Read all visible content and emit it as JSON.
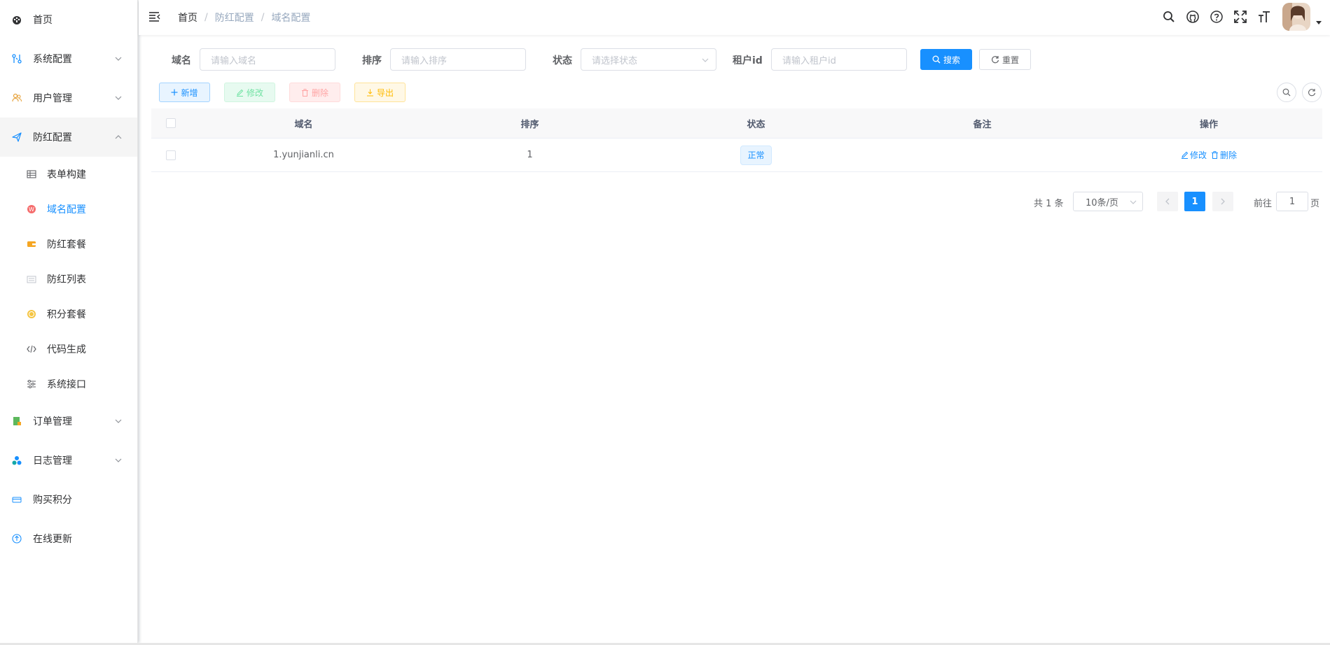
{
  "sidebar": {
    "items": [
      {
        "label": "首页"
      },
      {
        "label": "系统配置"
      },
      {
        "label": "用户管理"
      },
      {
        "label": "防红配置"
      },
      {
        "label": "订单管理"
      },
      {
        "label": "日志管理"
      },
      {
        "label": "购买积分"
      },
      {
        "label": "在线更新"
      }
    ],
    "sub_items": [
      {
        "label": "表单构建"
      },
      {
        "label": "域名配置"
      },
      {
        "label": "防红套餐"
      },
      {
        "label": "防红列表"
      },
      {
        "label": "积分套餐"
      },
      {
        "label": "代码生成"
      },
      {
        "label": "系统接口"
      }
    ]
  },
  "breadcrumb": {
    "home": "首页",
    "level1": "防红配置",
    "level2": "域名配置",
    "separator": "/"
  },
  "search_form": {
    "domain_label": "域名",
    "domain_placeholder": "请输入域名",
    "sort_label": "排序",
    "sort_placeholder": "请输入排序",
    "status_label": "状态",
    "status_placeholder": "请选择状态",
    "tenant_label": "租户id",
    "tenant_placeholder": "请输入租户id",
    "search_button": "搜索",
    "reset_button": "重置"
  },
  "toolbar": {
    "add": "新增",
    "edit": "修改",
    "delete": "删除",
    "export": "导出"
  },
  "table": {
    "headers": [
      "域名",
      "排序",
      "状态",
      "备注",
      "操作"
    ],
    "rows": [
      {
        "domain": "1.yunjianli.cn",
        "sort": "1",
        "status": "正常",
        "remark": "",
        "edit": "修改",
        "delete": "删除"
      }
    ]
  },
  "pagination": {
    "total": "共 1 条",
    "page_size": "10条/页",
    "current_page": "1",
    "goto_label": "前往",
    "goto_value": "1",
    "page_suffix": "页"
  },
  "colors": {
    "primary": "#1890ff",
    "success": "#13ce66",
    "danger": "#ff4949",
    "warning": "#ffba00"
  }
}
